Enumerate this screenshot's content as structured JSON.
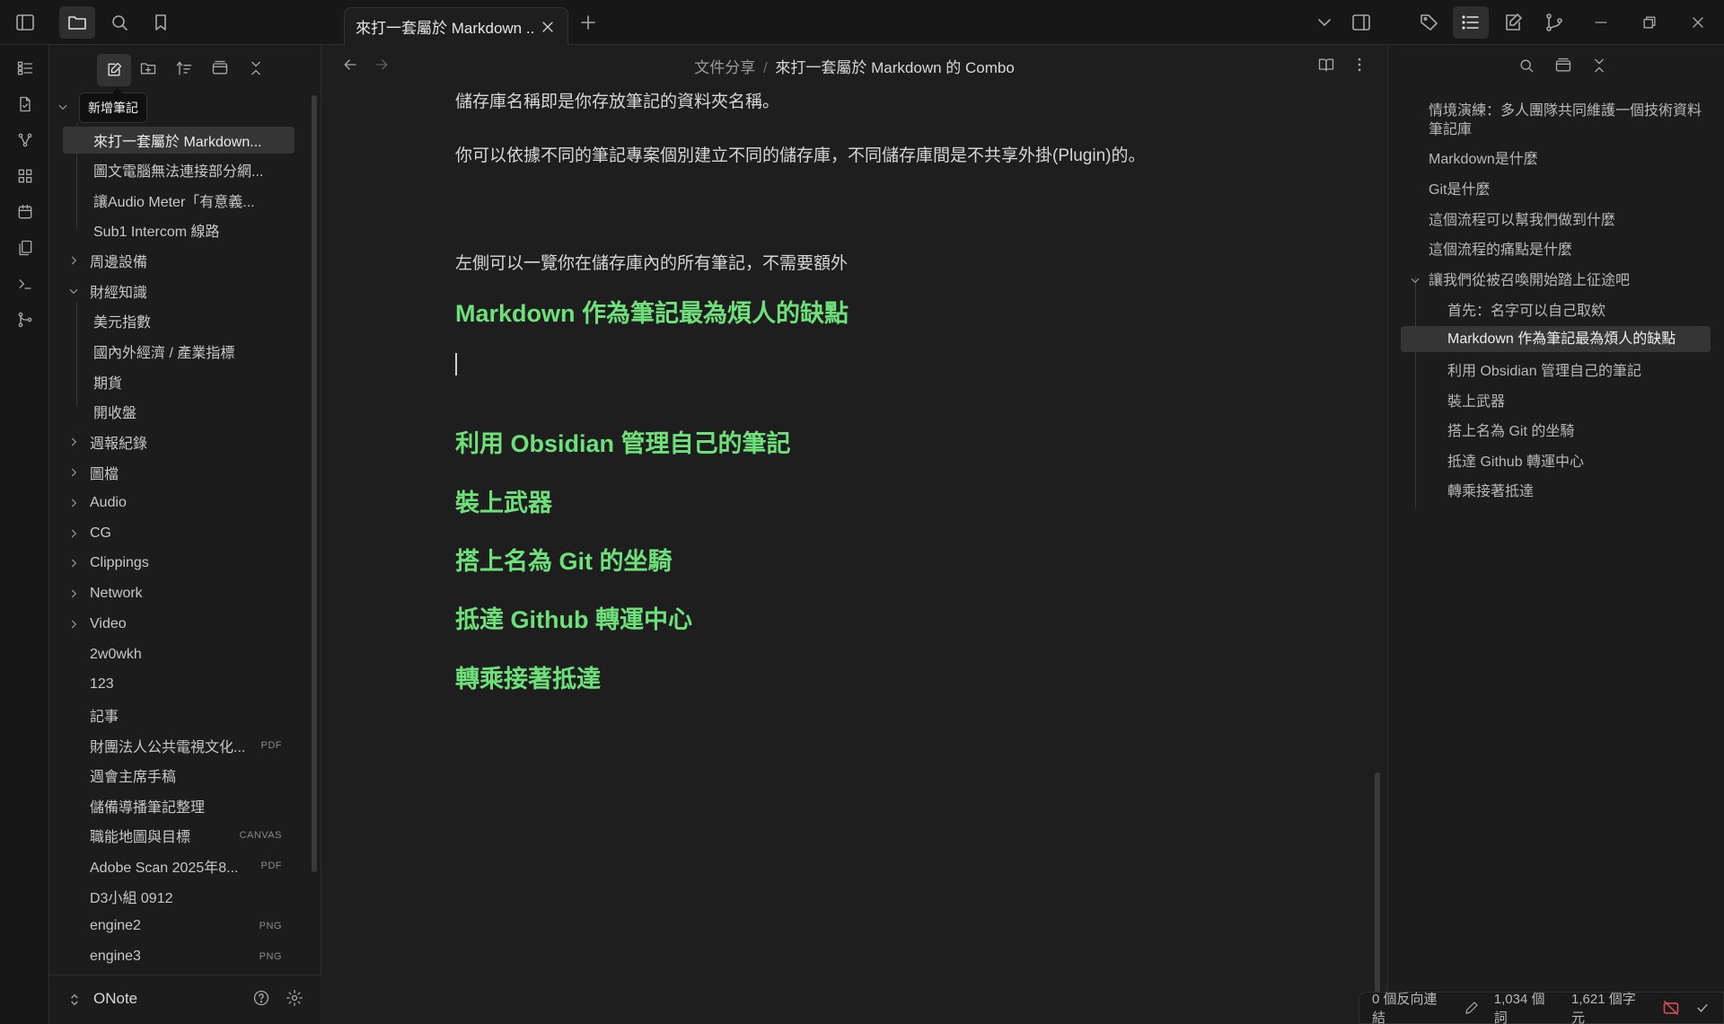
{
  "tab": {
    "title": "來打一套屬於 Markdown ..."
  },
  "tooltip": "新增筆記",
  "breadcrumb": {
    "folder": "文件分享",
    "separator": "/",
    "note": "來打一套屬於 Markdown 的 Combo"
  },
  "file_tree": {
    "items": [
      {
        "label": "來打一套屬於 Markdown...",
        "selected": true
      },
      {
        "label": "圖文電腦無法連接部分網..."
      },
      {
        "label": "讓Audio Meter「有意義..."
      },
      {
        "label": "Sub1 Intercom 線路"
      },
      {
        "label": "周邊設備"
      },
      {
        "label": "財經知識"
      },
      {
        "label": "美元指數"
      },
      {
        "label": "國內外經濟 / 產業指標"
      },
      {
        "label": "期貨"
      },
      {
        "label": "開收盤"
      },
      {
        "label": "週報紀錄"
      },
      {
        "label": "圖檔"
      },
      {
        "label": "Audio"
      },
      {
        "label": "CG"
      },
      {
        "label": "Clippings"
      },
      {
        "label": "Network"
      },
      {
        "label": "Video"
      },
      {
        "label": "2w0wkh"
      },
      {
        "label": "123"
      },
      {
        "label": "記事"
      },
      {
        "label": "財團法人公共電視文化...",
        "badge": "PDF"
      },
      {
        "label": "週會主席手稿"
      },
      {
        "label": "儲備導播筆記整理"
      },
      {
        "label": "職能地圖與目標",
        "badge": "CANVAS"
      },
      {
        "label": "Adobe Scan 2025年8...",
        "badge": "PDF"
      },
      {
        "label": "D3小組 0912"
      },
      {
        "label": "engine2",
        "badge": "PNG"
      },
      {
        "label": "engine3",
        "badge": "PNG"
      }
    ]
  },
  "vault": {
    "name": "ONote"
  },
  "editor": {
    "paragraphs": [
      "儲存庫名稱即是你存放筆記的資料夾名稱。",
      "你可以依據不同的筆記專案個別建立不同的儲存庫，不同儲存庫間是不共享外掛(Plugin)的。",
      "左側可以一覽你在儲存庫內的所有筆記，不需要額外"
    ],
    "headings": [
      "Markdown 作為筆記最為煩人的缺點",
      "利用 Obsidian 管理自己的筆記",
      "裝上武器",
      "搭上名為 Git 的坐騎",
      "抵達 Github 轉運中心",
      "轉乘接著抵達"
    ]
  },
  "outline": {
    "items": [
      {
        "label": "情境演練：多人團隊共同維護一個技術資料筆記庫"
      },
      {
        "label": "Markdown是什麼"
      },
      {
        "label": "Git是什麼"
      },
      {
        "label": "這個流程可以幫我們做到什麼"
      },
      {
        "label": "這個流程的痛點是什麼"
      },
      {
        "label": "讓我們從被召喚開始踏上征途吧"
      },
      {
        "label": "首先：名字可以自己取欸"
      },
      {
        "label": "Markdown 作為筆記最為煩人的缺點",
        "selected": true
      },
      {
        "label": "利用 Obsidian 管理自己的筆記"
      },
      {
        "label": "裝上武器"
      },
      {
        "label": "搭上名為 Git 的坐騎"
      },
      {
        "label": "抵達 Github 轉運中心"
      },
      {
        "label": "轉乘接著抵達"
      }
    ]
  },
  "status": {
    "backlinks": "0 個反向連結",
    "words": "1,034 個詞",
    "chars": "1,621 個字元"
  },
  "colors": {
    "heading": "#6ee07a",
    "background": "#1e1e1e",
    "sync_error": "#e05252"
  }
}
